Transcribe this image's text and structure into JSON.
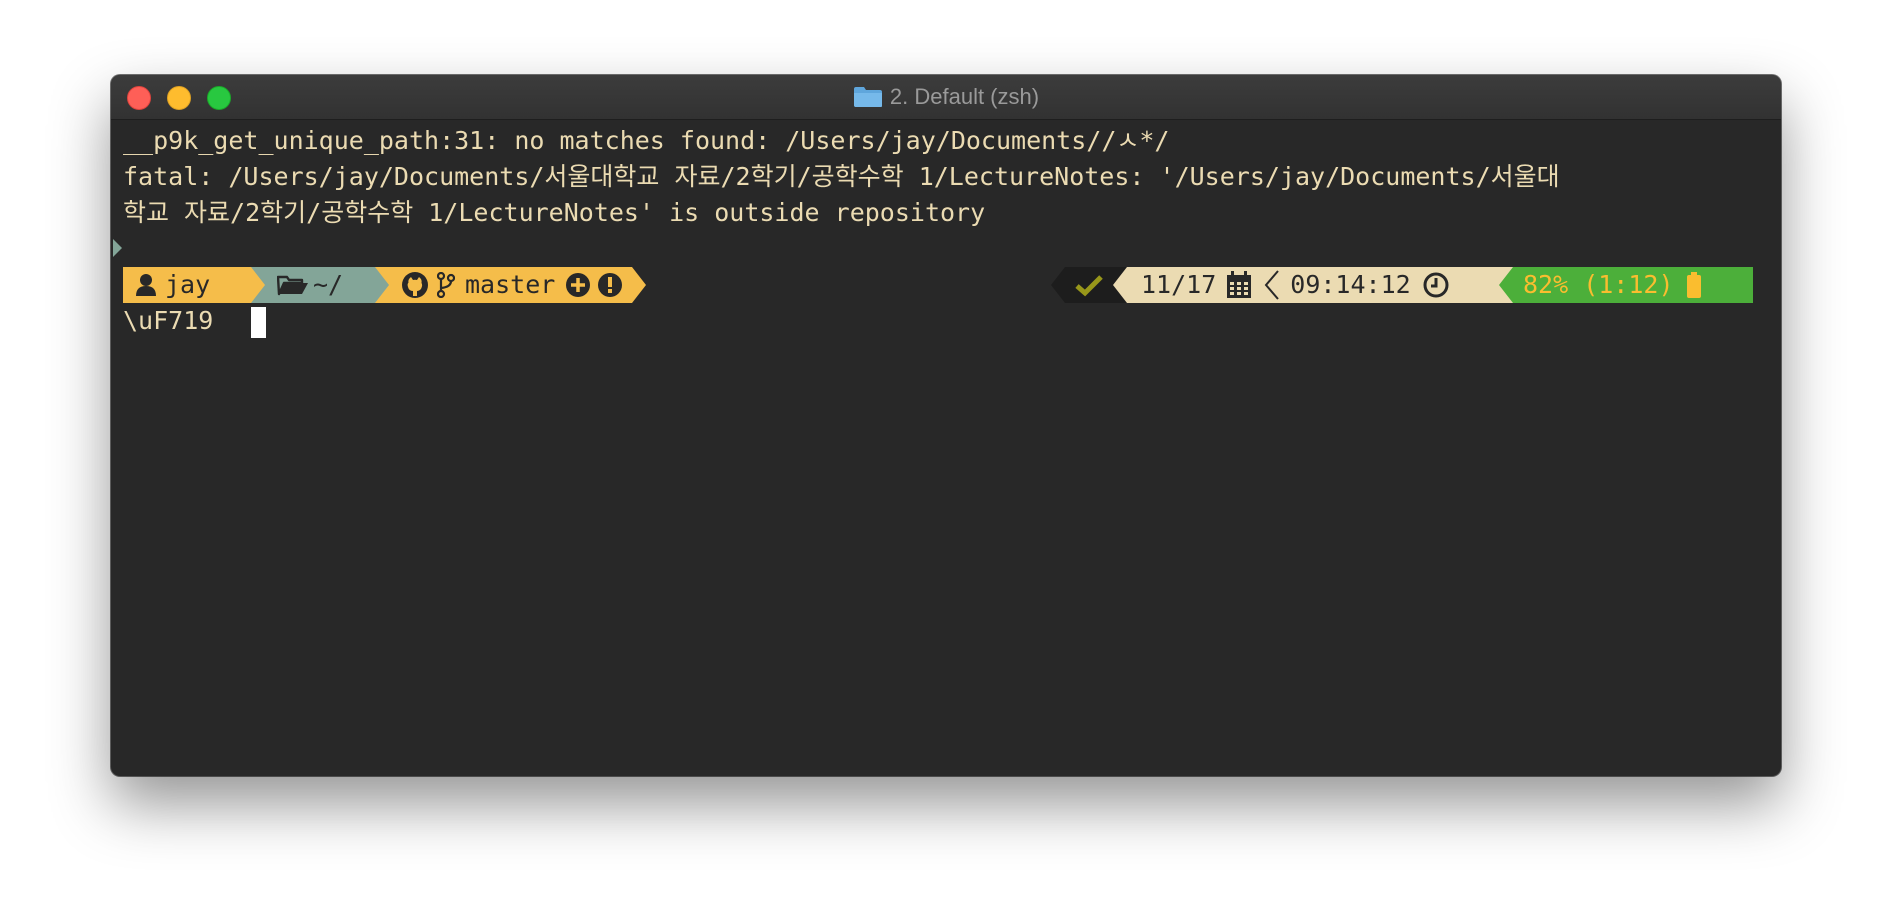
{
  "window": {
    "title": "2. Default (zsh)"
  },
  "output": {
    "lines": [
      "__p9k_get_unique_path:31: no matches found: /Users/jay/Documents//ㅅ*/",
      "fatal: /Users/jay/Documents/서울대학교 자료/2학기/공학수학 1/LectureNotes: '/Users/jay/Documents/서울대",
      "학교 자료/2학기/공학수학 1/LectureNotes' is outside repository"
    ]
  },
  "prompt": {
    "left": {
      "user": "jay",
      "dir": "~/",
      "branch": "master"
    },
    "right": {
      "date": "11/17",
      "time": "09:14:12",
      "battery": "82% (1:12)"
    }
  },
  "input": {
    "text": "\\uF719"
  },
  "colors": {
    "user_bg": "#f5bd4a",
    "dir_bg": "#83a598",
    "vcs_bg": "#f5bd4a",
    "status_bg": "#1d1d1d",
    "status_ok": "#98971a",
    "date_bg": "#ebdbb2",
    "battery_bg": "#4caf3a",
    "battery_fg": "#fabd2f"
  },
  "icons": {
    "user": "user-icon",
    "dir": "folder-open-icon",
    "github": "github-icon",
    "branch": "git-branch-icon",
    "staged": "plus-circle-icon",
    "unstaged": "exclamation-circle-icon",
    "status": "checkmark-icon",
    "date": "calendar-icon",
    "time": "clock-icon",
    "battery": "battery-icon"
  }
}
